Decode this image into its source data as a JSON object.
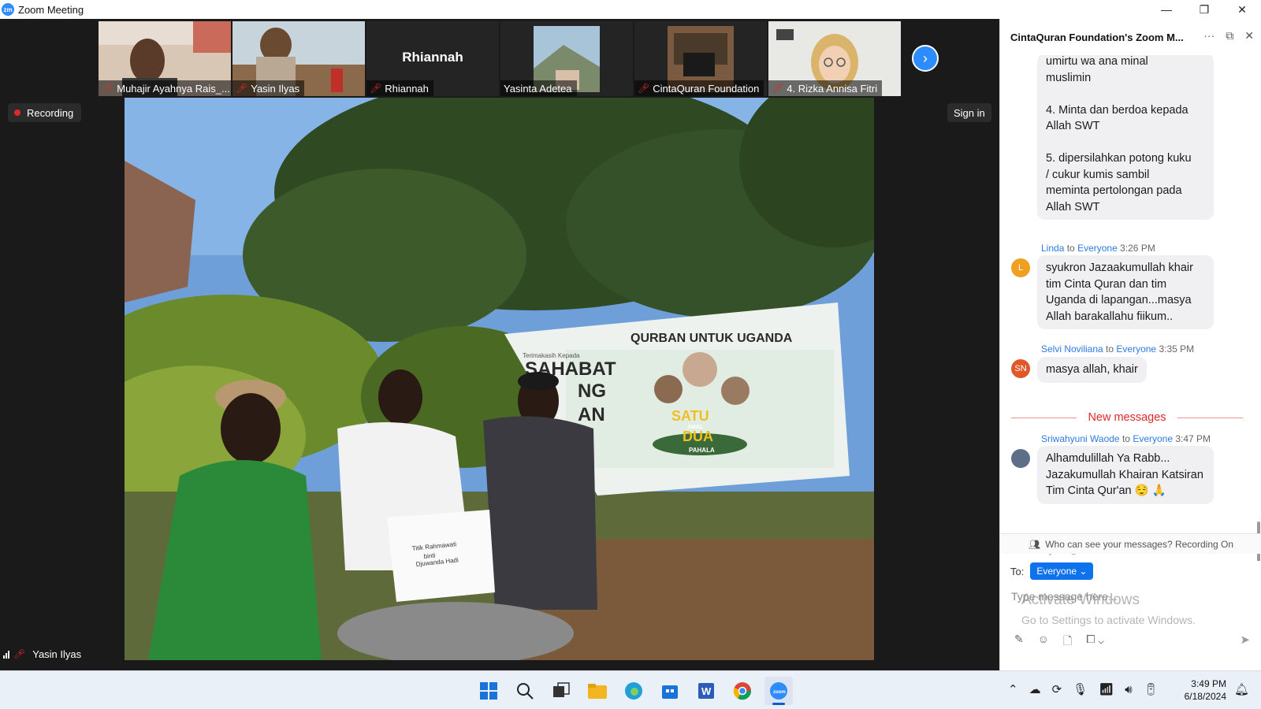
{
  "window": {
    "app_icon": "zm",
    "title": "Zoom Meeting",
    "controls": [
      "—",
      "❐",
      "✕"
    ]
  },
  "participants": [
    {
      "name": "Muhajir Ayahnya Rais_...",
      "muted": true
    },
    {
      "name": "Yasin Ilyas",
      "muted": true
    },
    {
      "name": "Rhiannah",
      "muted": true,
      "display_name": "Rhiannah"
    },
    {
      "name": "Yasinta Adetea",
      "muted": false
    },
    {
      "name": "CintaQuran Foundation",
      "muted": true
    },
    {
      "name": "4. Rizka Annisa Fitri",
      "muted": true
    }
  ],
  "recording_label": "Recording",
  "signin_label": "Sign in",
  "active_speaker": "Yasin Ilyas",
  "video": {
    "banner_title": "QURBAN UNTUK UGANDA",
    "banner_left_small": "Terimakasih Kepada",
    "banner_left_big": "SAHABAT",
    "banner_left_big2": "NG",
    "banner_left_big3": "AN",
    "banner_slogan_1": "SATU",
    "banner_slogan_2": "AMAL",
    "banner_slogan_3": "DUA",
    "banner_slogan_4": "PAHALA",
    "paper_line1": "Titik Rahmawati",
    "paper_line2": "binti",
    "paper_line3": "Djuwanda Hadi"
  },
  "chat": {
    "title": "CintaQuran Foundation's Zoom M...",
    "header_icons": [
      "more-icon",
      "popout-icon",
      "close-icon"
    ],
    "prev_message_lines": [
      "umirtu wa ana minal",
      "muslimin",
      "",
      "4. Minta dan berdoa kepada",
      "Allah SWT",
      "",
      "5. dipersilahkan potong kuku",
      "/ cukur kumis sambil",
      "meminta pertolongan pada",
      "Allah SWT"
    ],
    "messages": [
      {
        "sender": "Linda",
        "to_word": "to",
        "recipient": "Everyone",
        "time": "3:26 PM",
        "initials": "L",
        "avatar_color": "#f0a020",
        "text": "syukron Jazaakumullah khair tim Cinta Quran dan tim Uganda di lapangan...masya Allah barakallahu fiikum.."
      },
      {
        "sender": "Selvi Noviliana",
        "to_word": "to",
        "recipient": "Everyone",
        "time": "3:35 PM",
        "initials": "SN",
        "avatar_color": "#e0582a",
        "text": "masya allah, khair"
      },
      {
        "sender": "Sriwahyuni Waode",
        "to_word": "to",
        "recipient": "Everyone",
        "time": "3:47 PM",
        "initials": "",
        "avatar_color": "#5c6f86",
        "text": "Alhamdulillah Ya Rabb... Jazakumullah Khairan Katsiran Tim Cinta Qur'an 😌 🙏"
      }
    ],
    "new_messages_label": "New messages",
    "visibility_note": "Who can see your messages? Recording On",
    "to_label": "To:",
    "recipient_button": "Everyone",
    "input_placeholder": "Type message here...",
    "watermark_line1": "Activate Windows",
    "watermark_line2": "Go to Settings to activate Windows."
  },
  "taskbar": {
    "time": "3:49 PM",
    "date": "6/18/2024",
    "apps": [
      "start-icon",
      "search-icon",
      "task-view-icon",
      "file-explorer-icon",
      "edge-icon",
      "store-icon",
      "word-icon",
      "chrome-icon",
      "zoom-icon"
    ]
  },
  "colors": {
    "zoom_blue": "#2d8cff",
    "link_blue": "#2d7ce0",
    "record_red": "#e02828",
    "bubble_bg": "#f0f0f3"
  }
}
